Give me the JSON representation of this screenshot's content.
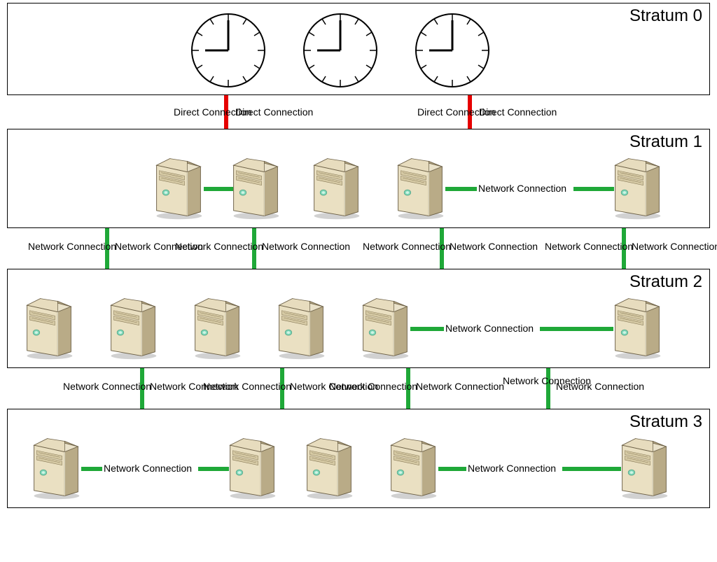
{
  "labels": {
    "stratum0": "Stratum 0",
    "stratum1": "Stratum 1",
    "stratum2": "Stratum 2",
    "stratum3": "Stratum 3",
    "direct": "Direct Connection",
    "network": "Network Connection"
  },
  "connections": {
    "s0_to_s1": {
      "type": "direct",
      "color": "#e60000",
      "count": 2
    },
    "s1_peer": {
      "type": "network",
      "color": "#1fa838"
    },
    "s1_to_s2": {
      "type": "network",
      "color": "#1fa838",
      "count": 4
    },
    "s2_peer": {
      "type": "network",
      "color": "#1fa838"
    },
    "s2_to_s3": {
      "type": "network",
      "color": "#1fa838",
      "count": 4
    },
    "s3_peer": {
      "type": "network",
      "color": "#1fa838",
      "count": 2
    }
  },
  "strata": [
    {
      "id": 0,
      "kind": "clocks",
      "count": 3
    },
    {
      "id": 1,
      "kind": "servers",
      "count": 5
    },
    {
      "id": 2,
      "kind": "servers",
      "count": 6
    },
    {
      "id": 3,
      "kind": "servers",
      "count": 5
    }
  ],
  "icons": {
    "clock": "clock-icon",
    "server": "server-icon"
  }
}
